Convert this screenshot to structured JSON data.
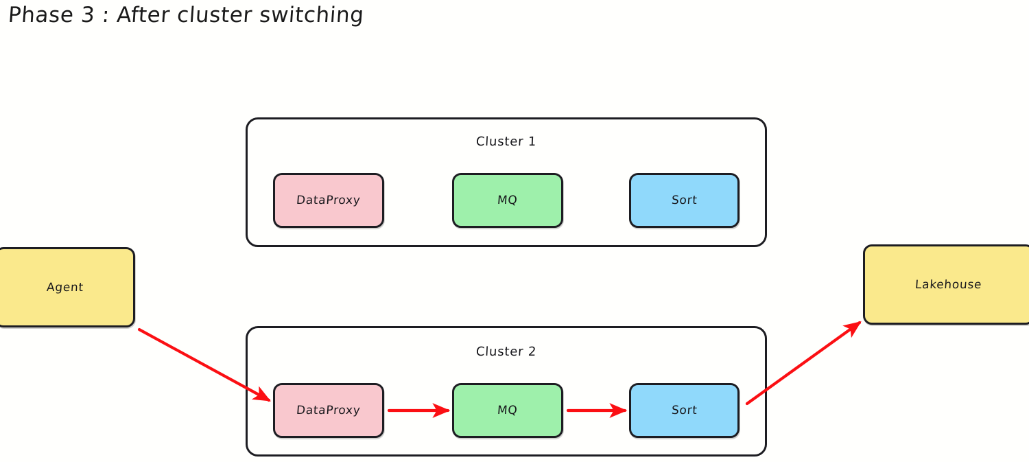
{
  "title": "Phase 3 : After cluster switching",
  "colors": {
    "background": "#fffffd",
    "stroke": "#1d1d22",
    "arrow": "#fb0f13",
    "pink": "#f9c8ce",
    "green": "#9ef0ab",
    "blue": "#90d9fb",
    "yellow": "#fae98c",
    "text": "#17171b"
  },
  "endpoints": {
    "agent": {
      "label": "Agent"
    },
    "lakehouse": {
      "label": "Lakehouse"
    }
  },
  "clusters": [
    {
      "id": "cluster-1",
      "label": "Cluster 1",
      "nodes": [
        {
          "id": "dataproxy",
          "label": "DataProxy",
          "color": "#f9c8ce"
        },
        {
          "id": "mq",
          "label": "MQ",
          "color": "#9ef0ab"
        },
        {
          "id": "sort",
          "label": "Sort",
          "color": "#90d9fb"
        }
      ],
      "active": false
    },
    {
      "id": "cluster-2",
      "label": "Cluster 2",
      "nodes": [
        {
          "id": "dataproxy",
          "label": "DataProxy",
          "color": "#f9c8ce"
        },
        {
          "id": "mq",
          "label": "MQ",
          "color": "#9ef0ab"
        },
        {
          "id": "sort",
          "label": "Sort",
          "color": "#90d9fb"
        }
      ],
      "active": true
    }
  ],
  "flow": {
    "edges": [
      {
        "from": "agent",
        "to": "cluster-2.dataproxy"
      },
      {
        "from": "cluster-2.dataproxy",
        "to": "cluster-2.mq"
      },
      {
        "from": "cluster-2.mq",
        "to": "cluster-2.sort"
      },
      {
        "from": "cluster-2.sort",
        "to": "lakehouse"
      }
    ]
  }
}
